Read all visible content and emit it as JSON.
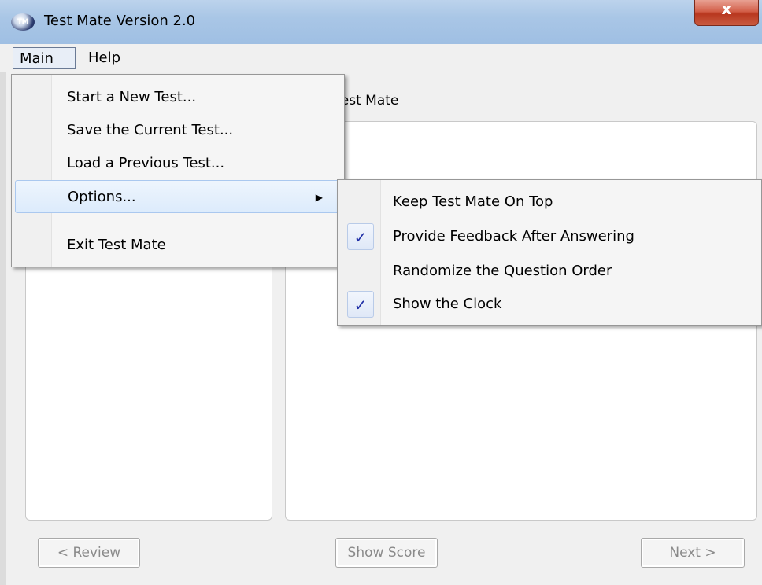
{
  "window": {
    "title": "Test Mate Version 2.0",
    "app_icon_text": "TM",
    "close_symbol": "x"
  },
  "menubar": {
    "items": [
      {
        "label": "Main",
        "open": true
      },
      {
        "label": "Help",
        "open": false
      }
    ]
  },
  "main_menu": {
    "items": [
      {
        "label": "Start a New Test..."
      },
      {
        "label": "Save the Current Test..."
      },
      {
        "label": "Load a Previous Test..."
      },
      {
        "label": "Options...",
        "has_submenu": true,
        "highlighted": true
      },
      {
        "label": "Exit Test Mate"
      }
    ],
    "submenu_arrow": "▶"
  },
  "options_menu": {
    "items": [
      {
        "label": "Keep Test Mate On Top",
        "checked": false
      },
      {
        "label": "Provide Feedback After Answering",
        "checked": true
      },
      {
        "label": "Randomize the Question Order",
        "checked": false
      },
      {
        "label": "Show the Clock",
        "checked": true
      }
    ],
    "check_symbol": "✓"
  },
  "content": {
    "welcome_text": "ome to Test Mate"
  },
  "buttons": {
    "review": "< Review",
    "show_score": "Show Score",
    "next": "Next >"
  },
  "colors": {
    "check": "#1f2fa6",
    "disabled_text": "#8a8a8a",
    "highlight": "#dcebfc"
  }
}
